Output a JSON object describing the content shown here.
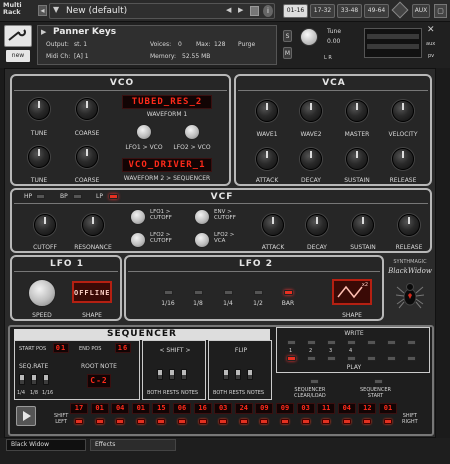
{
  "app": {
    "rack_label": "Multi\nRack"
  },
  "header": {
    "preset_name": "New (default)",
    "page_tabs": [
      "01-16",
      "17-32",
      "33-48",
      "49-64"
    ],
    "aux": "AUX"
  },
  "instrument": {
    "name": "Panner Keys",
    "output_label": "Output:",
    "output_value": "st. 1",
    "midi_label": "Midi Ch:",
    "midi_value": "[A]  1",
    "voices_label": "Voices:",
    "voices_value": "0",
    "max_label": "Max:",
    "max_value": "128",
    "memory_label": "Memory:",
    "memory_value": "52.55 MB",
    "purge_label": "Purge",
    "tune_label": "Tune",
    "tune_value": "0.00",
    "new_label": "new",
    "s_label": "S",
    "m_label": "M",
    "pan_label": "L    R",
    "aux_short": "aux",
    "pv_label": "pv"
  },
  "vco": {
    "title": "VCO",
    "wave1_display": "TUBED_RES_2",
    "wave1_label": "WAVEFORM 1",
    "wave2_display": "VCO_DRIVER_1",
    "wave2_label": "WAVEFORM 2 > SEQUENCER",
    "knobs": [
      "TUNE",
      "COARSE",
      "TUNE",
      "COARSE"
    ],
    "lfo1_vco": "LFO1 > VCO",
    "lfo2_vco": "LFO2 > VCO"
  },
  "vca": {
    "title": "VCA",
    "knobs_row1": [
      "WAVE1",
      "WAVE2",
      "MASTER",
      "VELOCITY"
    ],
    "knobs_row2": [
      "ATTACK",
      "DECAY",
      "SUSTAIN",
      "RELEASE"
    ]
  },
  "vcf": {
    "title": "VCF",
    "modes": [
      "HP",
      "BP",
      "LP"
    ],
    "active_mode": "LP",
    "knobs_left": [
      "CUTOFF",
      "RESONANCE"
    ],
    "mods": [
      "LFO1 >\nCUTOFF",
      "LFO2 >\nCUTOFF",
      "ENV >\nCUTOFF",
      "LFO2 >\nVCA"
    ],
    "knobs_right": [
      "ATTACK",
      "DECAY",
      "SUSTAIN",
      "RELEASE"
    ]
  },
  "lfo1": {
    "title": "LFO 1",
    "shape_display": "OFFLINE",
    "speed_label": "SPEED",
    "shape_label": "SHAPE"
  },
  "lfo2": {
    "title": "LFO 2",
    "rates": [
      "1/16",
      "1/8",
      "1/4",
      "1/2",
      "BAR"
    ],
    "active_rate": "BAR",
    "shape_label": "SHAPE",
    "shape_badge": "x2"
  },
  "brand": {
    "line1": "SYNTHMAGIC",
    "line2": "BlackWidow"
  },
  "sequencer": {
    "title": "SEQUENCER",
    "start_pos_label": "START POS",
    "start_pos_value": "01",
    "end_pos_label": "END POS",
    "end_pos_value": "16",
    "seq_rate_label": "SEQ.RATE",
    "seq_rates": [
      "1/4",
      "1/8",
      "1/16"
    ],
    "root_note_label": "ROOT NOTE",
    "root_note_value": "C-2",
    "shift_label": "< SHIFT >",
    "shift_opts": [
      "BOTH",
      "RESTS",
      "NOTES"
    ],
    "flip_label": "FLIP",
    "flip_opts": [
      "BOTH",
      "RESTS",
      "NOTES"
    ],
    "write_label": "WRITE",
    "play_label": "PLAY",
    "slots": [
      "1",
      "2",
      "3",
      "4"
    ],
    "clear_load": "SEQUENCER\nCLEAR/LOAD",
    "start_label": "SEQUENCER\nSTART",
    "shift_left": "SHIFT\nLEFT",
    "shift_right": "SHIFT\nRIGHT",
    "steps": [
      "17",
      "01",
      "04",
      "01",
      "15",
      "06",
      "16",
      "03",
      "24",
      "09",
      "09",
      "03",
      "11",
      "04",
      "12",
      "01"
    ]
  },
  "status": {
    "preset": "Black Widow",
    "effects": "Effects"
  },
  "colors": {
    "led_red": "#ff2a1a",
    "accent": "#e63021"
  }
}
